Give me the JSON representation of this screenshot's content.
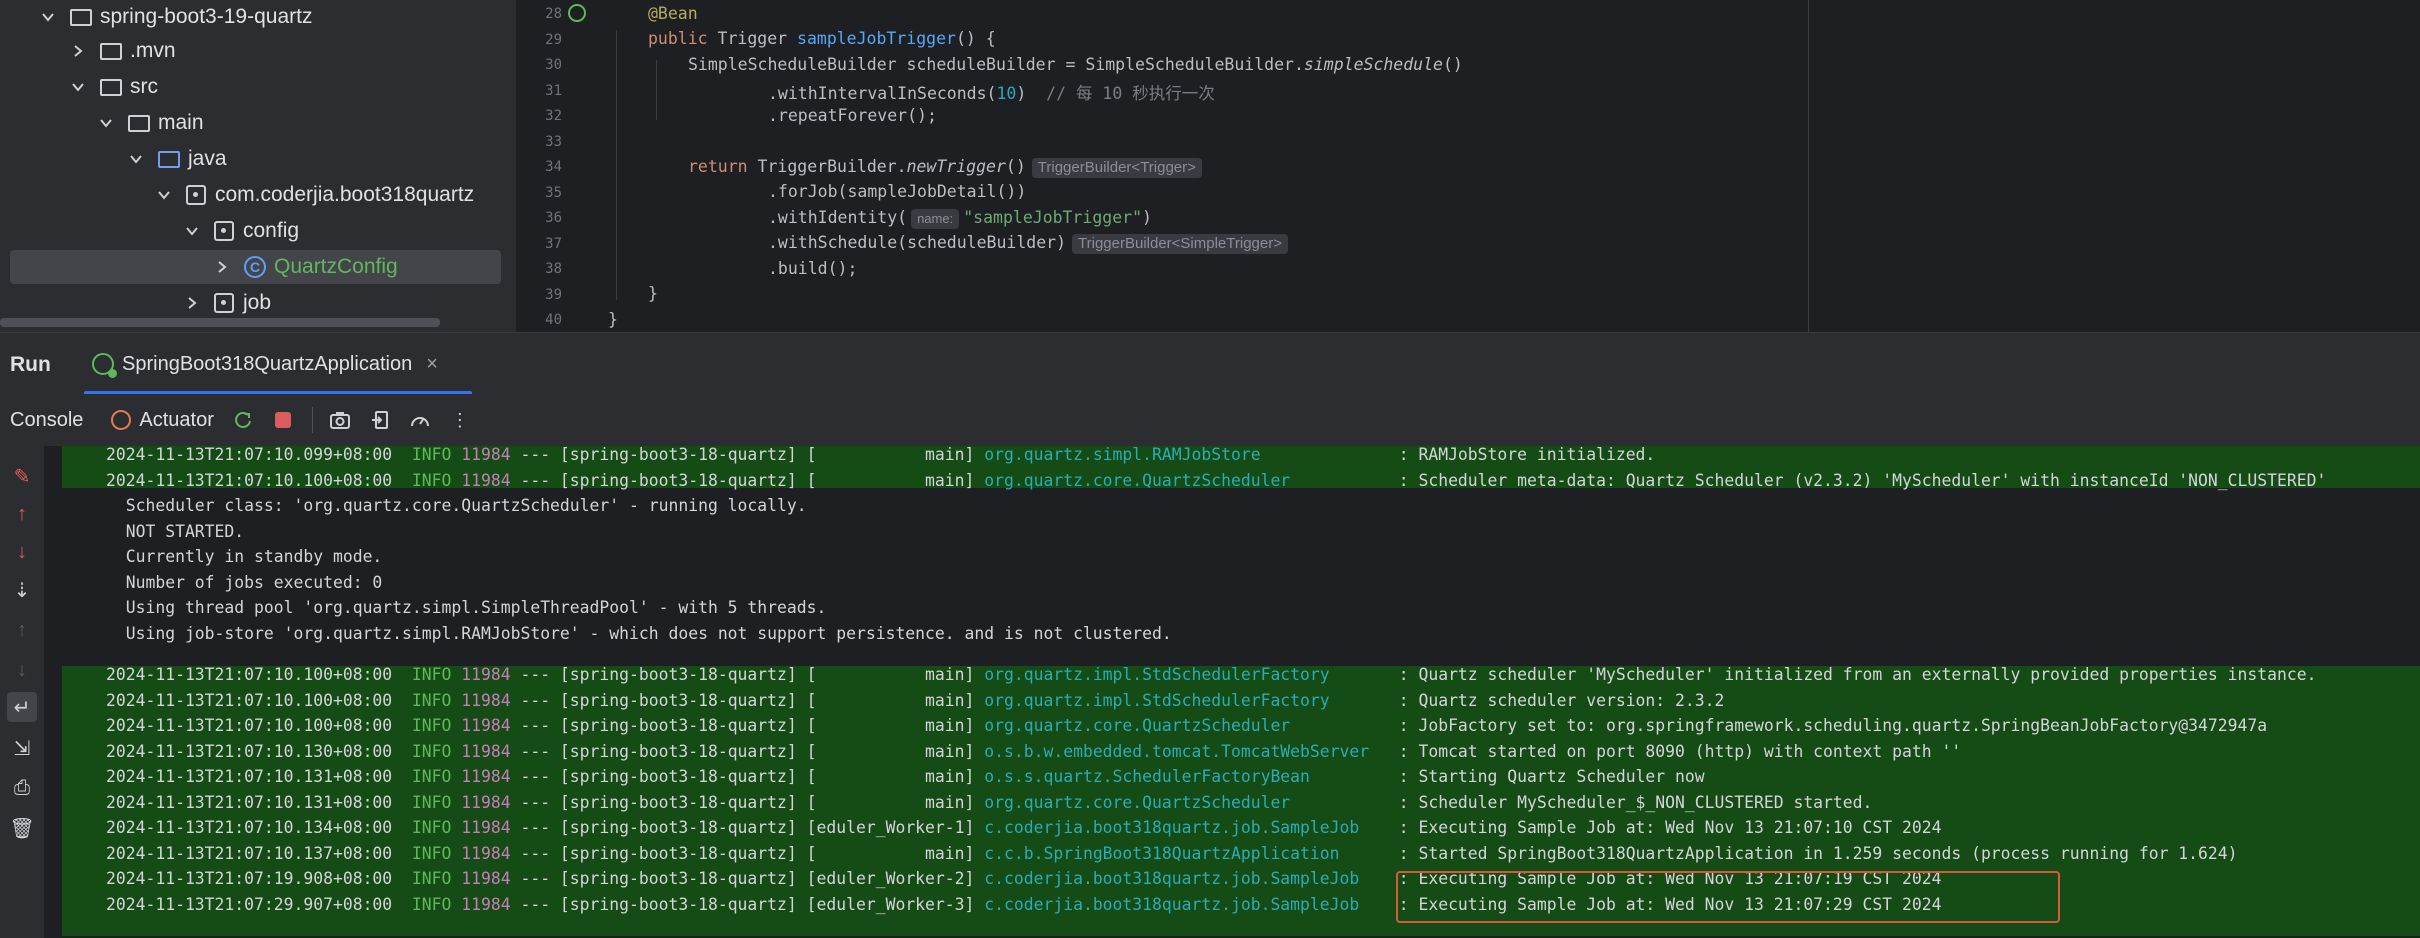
{
  "project": {
    "items": [
      {
        "label": "spring-boot3-19-quartz",
        "kind": "module"
      },
      {
        "label": ".mvn",
        "kind": "folder"
      },
      {
        "label": "src",
        "kind": "folder"
      },
      {
        "label": "main",
        "kind": "folder"
      },
      {
        "label": "java",
        "kind": "folder-blue"
      },
      {
        "label": "com.coderjia.boot318quartz",
        "kind": "package"
      },
      {
        "label": "config",
        "kind": "package"
      },
      {
        "label": "QuartzConfig",
        "kind": "class"
      },
      {
        "label": "job",
        "kind": "package"
      }
    ]
  },
  "editor": {
    "line_numbers": [
      "28",
      "29",
      "30",
      "31",
      "32",
      "33",
      "34",
      "35",
      "36",
      "37",
      "38",
      "39",
      "40"
    ],
    "code": {
      "l28": "@Bean",
      "l29_kw": "public",
      "l29_type": " Trigger ",
      "l29_fn": "sampleJobTrigger",
      "l29_rest": "() {",
      "l30_a": "SimpleScheduleBuilder scheduleBuilder = SimpleScheduleBuilder.",
      "l30_fn": "simpleSchedule",
      "l30_b": "()",
      "l31_a": ".withIntervalInSeconds(",
      "l31_num": "10",
      "l31_b": ")  ",
      "l31_cmt": "// 每 10 秒执行一次",
      "l32": ".repeatForever();",
      "l34_kw": "return",
      "l34_a": " TriggerBuilder.",
      "l34_fn": "newTrigger",
      "l34_b": "()",
      "l34_hint": "TriggerBuilder<Trigger>",
      "l35": ".forJob(sampleJobDetail())",
      "l36_a": ".withIdentity(",
      "l36_hint": "name:",
      "l36_str": "\"sampleJobTrigger\"",
      "l36_b": ")",
      "l37": ".withSchedule(scheduleBuilder)",
      "l37_hint": "TriggerBuilder<SimpleTrigger>",
      "l38": ".build();",
      "l39": "}",
      "l40": "}"
    }
  },
  "run": {
    "title": "Run",
    "tab_label": "SpringBoot318QuartzApplication",
    "tab_close": "×",
    "console_label": "Console",
    "actuator_label": "Actuator"
  },
  "console": {
    "block1": [
      {
        "ts": "2024-11-13T21:07:10.099+08:00",
        "level": "INFO",
        "pid": "11984",
        "mid": " --- [spring-boot3-18-quartz] [           main] ",
        "logger": "org.quartz.simpl.RAMJobStore             ",
        "msg": " : RAMJobStore initialized."
      },
      {
        "ts": "2024-11-13T21:07:10.100+08:00",
        "level": "INFO",
        "pid": "11984",
        "mid": " --- [spring-boot3-18-quartz] [           main] ",
        "logger": "org.quartz.core.QuartzScheduler          ",
        "msg": " : Scheduler meta-data: Quartz Scheduler (v2.3.2) 'MyScheduler' with instanceId 'NON_CLUSTERED'"
      }
    ],
    "plain": [
      "  Scheduler class: 'org.quartz.core.QuartzScheduler' - running locally.",
      "  NOT STARTED.",
      "  Currently in standby mode.",
      "  Number of jobs executed: 0",
      "  Using thread pool 'org.quartz.simpl.SimpleThreadPool' - with 5 threads.",
      "  Using job-store 'org.quartz.simpl.RAMJobStore' - which does not support persistence. and is not clustered."
    ],
    "block2": [
      {
        "ts": "2024-11-13T21:07:10.100+08:00",
        "level": "INFO",
        "pid": "11984",
        "mid": " --- [spring-boot3-18-quartz] [           main] ",
        "logger": "org.quartz.impl.StdSchedulerFactory      ",
        "msg": " : Quartz scheduler 'MyScheduler' initialized from an externally provided properties instance."
      },
      {
        "ts": "2024-11-13T21:07:10.100+08:00",
        "level": "INFO",
        "pid": "11984",
        "mid": " --- [spring-boot3-18-quartz] [           main] ",
        "logger": "org.quartz.impl.StdSchedulerFactory      ",
        "msg": " : Quartz scheduler version: 2.3.2"
      },
      {
        "ts": "2024-11-13T21:07:10.100+08:00",
        "level": "INFO",
        "pid": "11984",
        "mid": " --- [spring-boot3-18-quartz] [           main] ",
        "logger": "org.quartz.core.QuartzScheduler          ",
        "msg": " : JobFactory set to: org.springframework.scheduling.quartz.SpringBeanJobFactory@3472947a"
      },
      {
        "ts": "2024-11-13T21:07:10.130+08:00",
        "level": "INFO",
        "pid": "11984",
        "mid": " --- [spring-boot3-18-quartz] [           main] ",
        "logger": "o.s.b.w.embedded.tomcat.TomcatWebServer  ",
        "msg": " : Tomcat started on port 8090 (http) with context path ''"
      },
      {
        "ts": "2024-11-13T21:07:10.131+08:00",
        "level": "INFO",
        "pid": "11984",
        "mid": " --- [spring-boot3-18-quartz] [           main] ",
        "logger": "o.s.s.quartz.SchedulerFactoryBean        ",
        "msg": " : Starting Quartz Scheduler now"
      },
      {
        "ts": "2024-11-13T21:07:10.131+08:00",
        "level": "INFO",
        "pid": "11984",
        "mid": " --- [spring-boot3-18-quartz] [           main] ",
        "logger": "org.quartz.core.QuartzScheduler          ",
        "msg": " : Scheduler MyScheduler_$_NON_CLUSTERED started."
      },
      {
        "ts": "2024-11-13T21:07:10.134+08:00",
        "level": "INFO",
        "pid": "11984",
        "mid": " --- [spring-boot3-18-quartz] [eduler_Worker-1] ",
        "logger": "c.coderjia.boot318quartz.job.SampleJob   ",
        "msg": " : Executing Sample Job at: Wed Nov 13 21:07:10 CST 2024"
      },
      {
        "ts": "2024-11-13T21:07:10.137+08:00",
        "level": "INFO",
        "pid": "11984",
        "mid": " --- [spring-boot3-18-quartz] [           main] ",
        "logger": "c.c.b.SpringBoot318QuartzApplication     ",
        "msg": " : Started SpringBoot318QuartzApplication in 1.259 seconds (process running for 1.624)"
      },
      {
        "ts": "2024-11-13T21:07:19.908+08:00",
        "level": "INFO",
        "pid": "11984",
        "mid": " --- [spring-boot3-18-quartz] [eduler_Worker-2] ",
        "logger": "c.coderjia.boot318quartz.job.SampleJob   ",
        "msg": " : Executing Sample Job at: Wed Nov 13 21:07:19 CST 2024"
      },
      {
        "ts": "2024-11-13T21:07:29.907+08:00",
        "level": "INFO",
        "pid": "11984",
        "mid": " --- [spring-boot3-18-quartz] [eduler_Worker-3] ",
        "logger": "c.coderjia.boot318quartz.job.SampleJob   ",
        "msg": " : Executing Sample Job at: Wed Nov 13 21:07:29 CST 2024"
      }
    ]
  },
  "colors": {
    "accent": "#3574f0",
    "log_highlight_bg": "#154b14",
    "highlight_box": "#d95a3a"
  }
}
